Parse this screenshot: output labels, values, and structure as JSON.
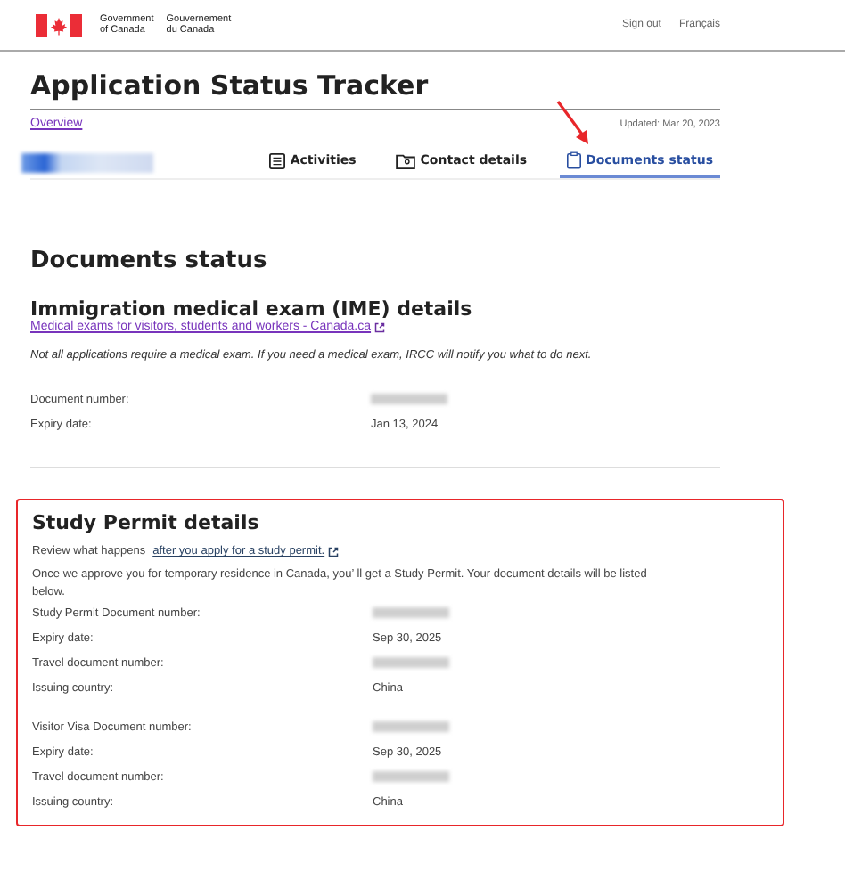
{
  "header": {
    "wordmark_en": [
      "Government",
      "of Canada"
    ],
    "wordmark_fr": [
      "Gouvernement",
      "du Canada"
    ],
    "links": [
      "Sign out",
      "Français"
    ]
  },
  "title": "Application Status Tracker",
  "overview_link": "Overview",
  "updated": "Updated: Mar 20, 2023",
  "tabs": [
    {
      "label": "Activities",
      "kind": "list",
      "selected": false
    },
    {
      "label": "Contact details",
      "kind": "contact",
      "selected": false
    },
    {
      "label": "Documents status",
      "kind": "clipboard",
      "selected": true
    }
  ],
  "annotation_arrow": true,
  "page_heading": "Documents status",
  "ime": {
    "heading": "Immigration medical exam (IME) details",
    "link": "Medical exams for visitors, students and workers - Canada.ca",
    "note": "Not all applications require a medical exam. If you need a medical exam, IRCC will notify you what to do next.",
    "fields": [
      {
        "label": "Document number:",
        "kind": "redacted"
      },
      {
        "label": "Expiry date:",
        "kind": "text",
        "value": "Jan 13, 2024"
      }
    ]
  },
  "study_permit": {
    "highlighted": true,
    "heading": "Study Permit details",
    "intro": "Review what happens",
    "intro_link": "after you apply for a study permit.",
    "paragraph": "Once we approve you for temporary residence in Canada, you’ ll get a Study Permit. Your document details will be listed below.",
    "groups": [
      [
        {
          "label": "Study Permit Document number:",
          "kind": "redacted"
        },
        {
          "label": "Expiry date:",
          "kind": "text",
          "value": "Sep 30, 2025"
        },
        {
          "label": "Travel document number:",
          "kind": "redacted"
        },
        {
          "label": "Issuing country:",
          "kind": "text",
          "value": "China"
        }
      ],
      [
        {
          "label": "Visitor Visa Document number:",
          "kind": "redacted"
        },
        {
          "label": "Expiry date:",
          "kind": "text",
          "value": "Sep 30, 2025"
        },
        {
          "label": "Travel document number:",
          "kind": "redacted"
        },
        {
          "label": "Issuing country:",
          "kind": "text",
          "value": "China"
        }
      ]
    ]
  }
}
